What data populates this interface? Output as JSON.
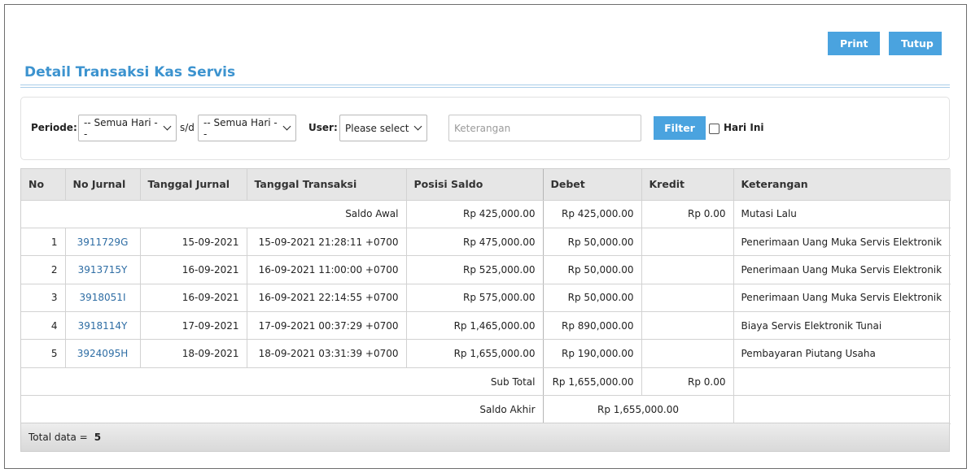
{
  "toolbar": {
    "print_label": "Print",
    "close_label": "Tutup"
  },
  "page_title": "Detail Transaksi Kas Servis",
  "filter": {
    "periode_label": "Periode:",
    "from_value": "-- Semua Hari --",
    "sd_label": "s/d",
    "to_value": "-- Semua Hari --",
    "user_label": "User:",
    "user_value": "Please select",
    "keterangan_placeholder": "Keterangan",
    "filter_label": "Filter",
    "hari_ini_label": "Hari Ini"
  },
  "table": {
    "headers": [
      "No",
      "No Jurnal",
      "Tanggal Jurnal",
      "Tanggal Transaksi",
      "Posisi Saldo",
      "Debet",
      "Kredit",
      "Keterangan"
    ],
    "saldo_awal": {
      "label": "Saldo Awal",
      "posisi": "Rp 425,000.00",
      "debet": "Rp 425,000.00",
      "kredit": "Rp 0.00",
      "keterangan": "Mutasi Lalu"
    },
    "rows": [
      {
        "no": "1",
        "jurnal": "3911729G",
        "tgl_jurnal": "15-09-2021",
        "tgl_transaksi": "15-09-2021 21:28:11 +0700",
        "posisi": "Rp 475,000.00",
        "debet": "Rp 50,000.00",
        "kredit": "",
        "keterangan": "Penerimaan Uang Muka Servis Elektronik"
      },
      {
        "no": "2",
        "jurnal": "3913715Y",
        "tgl_jurnal": "16-09-2021",
        "tgl_transaksi": "16-09-2021 11:00:00 +0700",
        "posisi": "Rp 525,000.00",
        "debet": "Rp 50,000.00",
        "kredit": "",
        "keterangan": "Penerimaan Uang Muka Servis Elektronik"
      },
      {
        "no": "3",
        "jurnal": "3918051I",
        "tgl_jurnal": "16-09-2021",
        "tgl_transaksi": "16-09-2021 22:14:55 +0700",
        "posisi": "Rp 575,000.00",
        "debet": "Rp 50,000.00",
        "kredit": "",
        "keterangan": "Penerimaan Uang Muka Servis Elektronik"
      },
      {
        "no": "4",
        "jurnal": "3918114Y",
        "tgl_jurnal": "17-09-2021",
        "tgl_transaksi": "17-09-2021 00:37:29 +0700",
        "posisi": "Rp 1,465,000.00",
        "debet": "Rp 890,000.00",
        "kredit": "",
        "keterangan": "Biaya Servis Elektronik Tunai"
      },
      {
        "no": "5",
        "jurnal": "3924095H",
        "tgl_jurnal": "18-09-2021",
        "tgl_transaksi": "18-09-2021 03:31:39 +0700",
        "posisi": "Rp 1,655,000.00",
        "debet": "Rp 190,000.00",
        "kredit": "",
        "keterangan": "Pembayaran Piutang Usaha"
      }
    ],
    "sub_total": {
      "label": "Sub Total",
      "debet": "Rp 1,655,000.00",
      "kredit": "Rp 0.00"
    },
    "saldo_akhir": {
      "label": "Saldo Akhir",
      "value": "Rp 1,655,000.00"
    }
  },
  "footer": {
    "total_label": "Total data =",
    "total_value": "5"
  },
  "colors": {
    "accent": "#4aa3df",
    "title": "#3c93cf",
    "link": "#2e6da4"
  }
}
